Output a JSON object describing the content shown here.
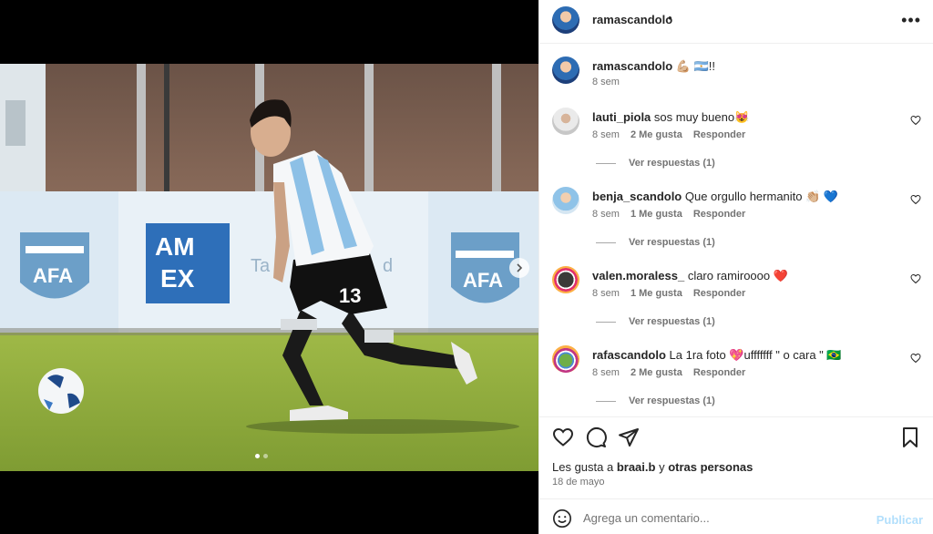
{
  "post": {
    "username": "ramascandolo",
    "header_separator": "•",
    "more_label": "•••",
    "image_alt": "Jugador con camiseta de Argentina número 13 conduciendo la pelota en una cancha de césped"
  },
  "media": {
    "banner_text_1": "AM",
    "banner_text_2": "EX",
    "banner_text_3": "Ta",
    "banner_text_4": "d",
    "badge_text": "AFA",
    "jersey_number": "13",
    "carousel_dots": 2,
    "active_dot": 0
  },
  "caption": {
    "username": "ramascandolo",
    "text": "💪🏼 🇦🇷!!",
    "time": "8 sem"
  },
  "comments": [
    {
      "username": "lauti_piola",
      "text": "sos muy bueno😻",
      "time": "8 sem",
      "likes": "2 Me gusta",
      "reply": "Responder",
      "view_replies": "Ver respuestas (1)"
    },
    {
      "username": "benja_scandolo",
      "text": "Que orgullo hermanito 👏🏼 💙",
      "time": "8 sem",
      "likes": "1 Me gusta",
      "reply": "Responder",
      "view_replies": "Ver respuestas (1)"
    },
    {
      "username": "valen.moraless_",
      "text": "claro ramiroooo ❤️",
      "time": "8 sem",
      "likes": "1 Me gusta",
      "reply": "Responder",
      "view_replies": "Ver respuestas (1)"
    },
    {
      "username": "rafascandolo",
      "text": "La 1ra foto 💖ufffffff \" o cara \" 🇧🇷",
      "time": "8 sem",
      "likes": "2 Me gusta",
      "reply": "Responder",
      "view_replies": "Ver respuestas (1)"
    }
  ],
  "actions": {
    "likes_prefix": "Les gusta a ",
    "liked_by": "braai.b",
    "likes_connector": " y ",
    "others": "otras personas",
    "date": "18 de mayo"
  },
  "add_comment": {
    "placeholder": "Agrega un comentario...",
    "publish": "Publicar"
  },
  "icons": {
    "like": "heart-icon",
    "comment": "comment-icon",
    "share": "paper-plane-icon",
    "save": "bookmark-icon",
    "emoji": "emoji-icon",
    "next": "chevron-right-icon"
  },
  "colors": {
    "publish_disabled": "#b2dffc",
    "secondary_text": "#737373",
    "primary_text": "#262626"
  }
}
